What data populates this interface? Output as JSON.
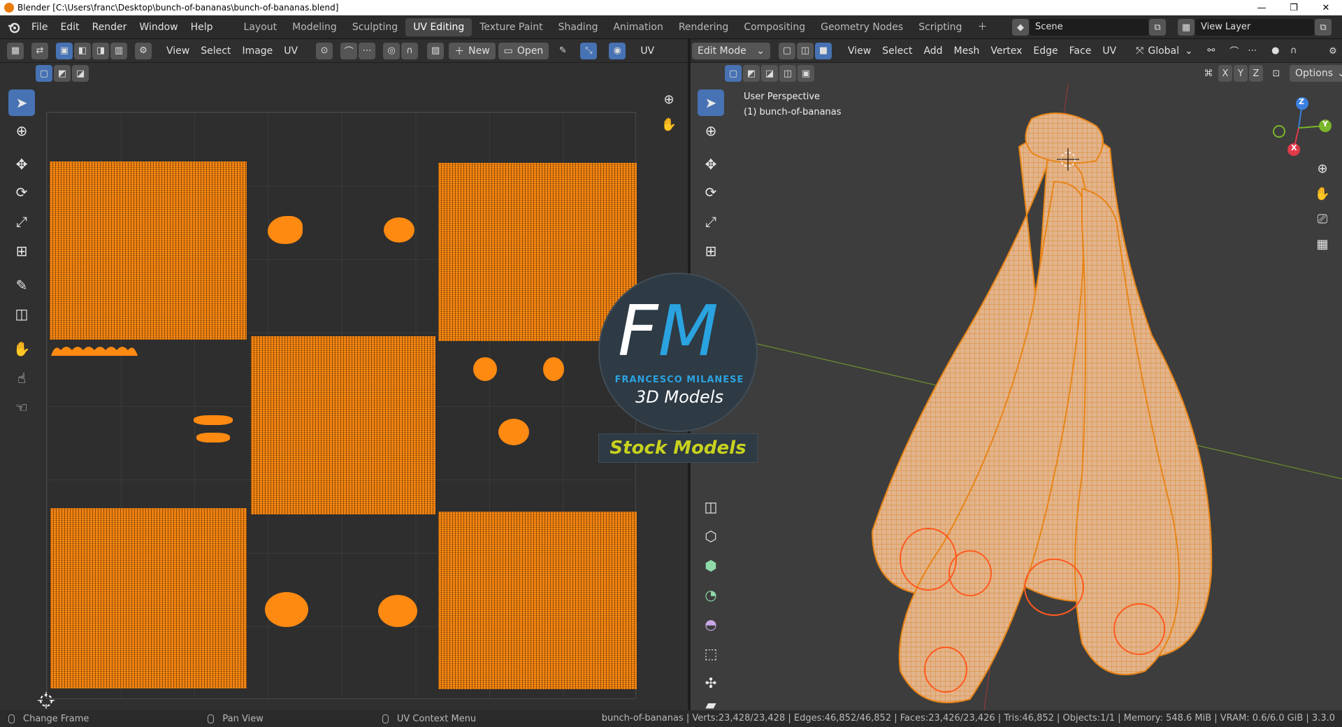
{
  "window": {
    "title": "Blender [C:\\Users\\franc\\Desktop\\bunch-of-bananas\\bunch-of-bananas.blend]",
    "minimize": "—",
    "maximize": "❐",
    "close": "✕"
  },
  "menus": [
    "File",
    "Edit",
    "Render",
    "Window",
    "Help"
  ],
  "workspaces": [
    "Layout",
    "Modeling",
    "Sculpting",
    "UV Editing",
    "Texture Paint",
    "Shading",
    "Animation",
    "Rendering",
    "Compositing",
    "Geometry Nodes",
    "Scripting"
  ],
  "active_workspace": "UV Editing",
  "scene": {
    "label": "Scene",
    "view_layer": "View Layer"
  },
  "uv_editor": {
    "menus": [
      "View",
      "Select",
      "Image",
      "UV"
    ],
    "new_label": "New",
    "open_label": "Open",
    "truncated_label": "UV"
  },
  "viewport": {
    "mode": "Edit Mode",
    "menus": [
      "View",
      "Select",
      "Add",
      "Mesh",
      "Vertex",
      "Edge",
      "Face",
      "UV"
    ],
    "orientation": "Global",
    "axes": [
      "X",
      "Y",
      "Z"
    ],
    "options": "Options",
    "overlay_line1": "User Perspective",
    "overlay_line2": "(1) bunch-of-bananas",
    "gizmo": {
      "x": "X",
      "y": "Y",
      "z": "Z"
    }
  },
  "watermark": {
    "initials_f": "F",
    "initials_m": "M",
    "name": "FRANCESCO MILANESE",
    "subtitle": "3D Models",
    "banner": "Stock Models"
  },
  "status": {
    "left": [
      {
        "label": "Change Frame"
      },
      {
        "label": "Pan View"
      },
      {
        "label": "UV Context Menu"
      }
    ],
    "stats": "bunch-of-bananas | Verts:23,428/23,428 | Edges:46,852/46,852 | Faces:23,426/23,426 | Tris:46,852 | Objects:1/1 | Memory: 548.6 MiB | VRAM: 0.6/6.0 GiB | 3.3.0"
  },
  "colors": {
    "uv_orange": "#ff8a12",
    "select_blue": "#4772b3",
    "banner_yellow": "#c8d21e",
    "fm_blue": "#2aa3e0"
  }
}
